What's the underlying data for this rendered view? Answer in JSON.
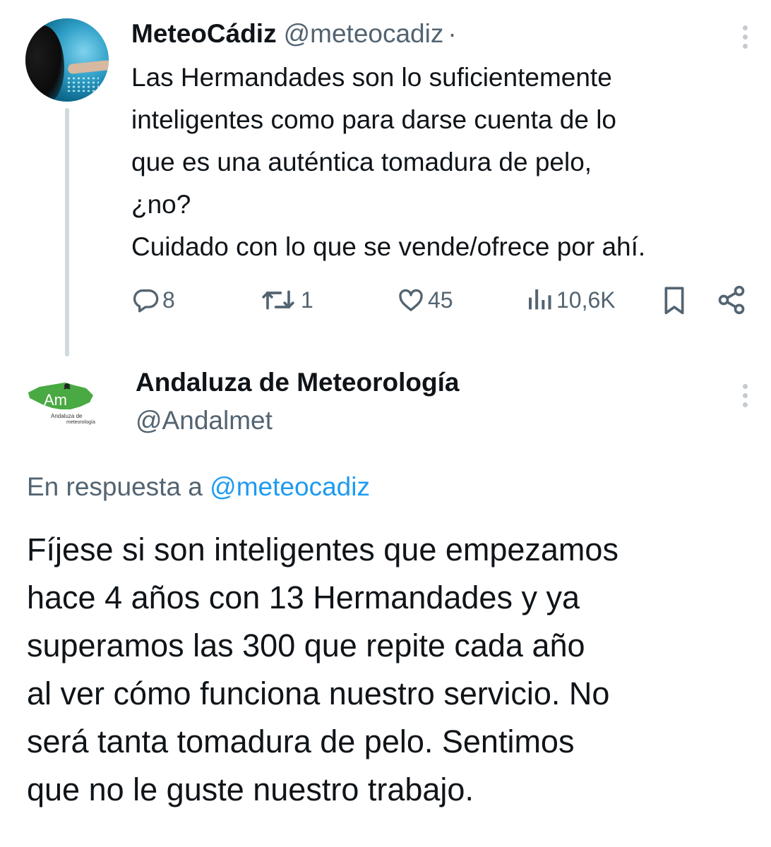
{
  "tweet1": {
    "author_name": "MeteoCádiz",
    "handle": "@meteocadiz",
    "separator": "·",
    "body_lines": [
      "Las Hermandades son lo suficientemente",
      "inteligentes como para darse cuenta de lo",
      "que es una auténtica tomadura de pelo,",
      "¿no?",
      "Cuidado con lo que se vende/ofrece por ahí."
    ],
    "actions": {
      "replies": "8",
      "retweets": "1",
      "likes": "45",
      "views": "10,6K"
    },
    "icons": [
      "reply-icon",
      "retweet-icon",
      "like-icon",
      "views-icon",
      "bookmark-icon",
      "share-icon",
      "more-icon"
    ]
  },
  "tweet2": {
    "author_name": "Andaluza de Meteorología",
    "handle": "@Andalmet",
    "avatar_logo": {
      "initials": "Am",
      "caption_line1": "Andaluza de",
      "caption_line2": "meteorología"
    },
    "reply_prefix": "En respuesta a",
    "reply_mention": "@meteocadiz",
    "body_lines": [
      "Fíjese si son inteligentes que empezamos",
      "hace 4 años con 13 Hermandades y ya",
      "superamos las 300 que repite cada año",
      "al ver cómo funciona nuestro servicio. No",
      "será tanta tomadura de pelo. Sentimos",
      "que no le guste nuestro trabajo."
    ]
  },
  "colors": {
    "text": "#0f1419",
    "secondary": "#536471",
    "link": "#1d9bf0",
    "thread_line": "#cfd9de",
    "logo_green": "#49a942"
  }
}
